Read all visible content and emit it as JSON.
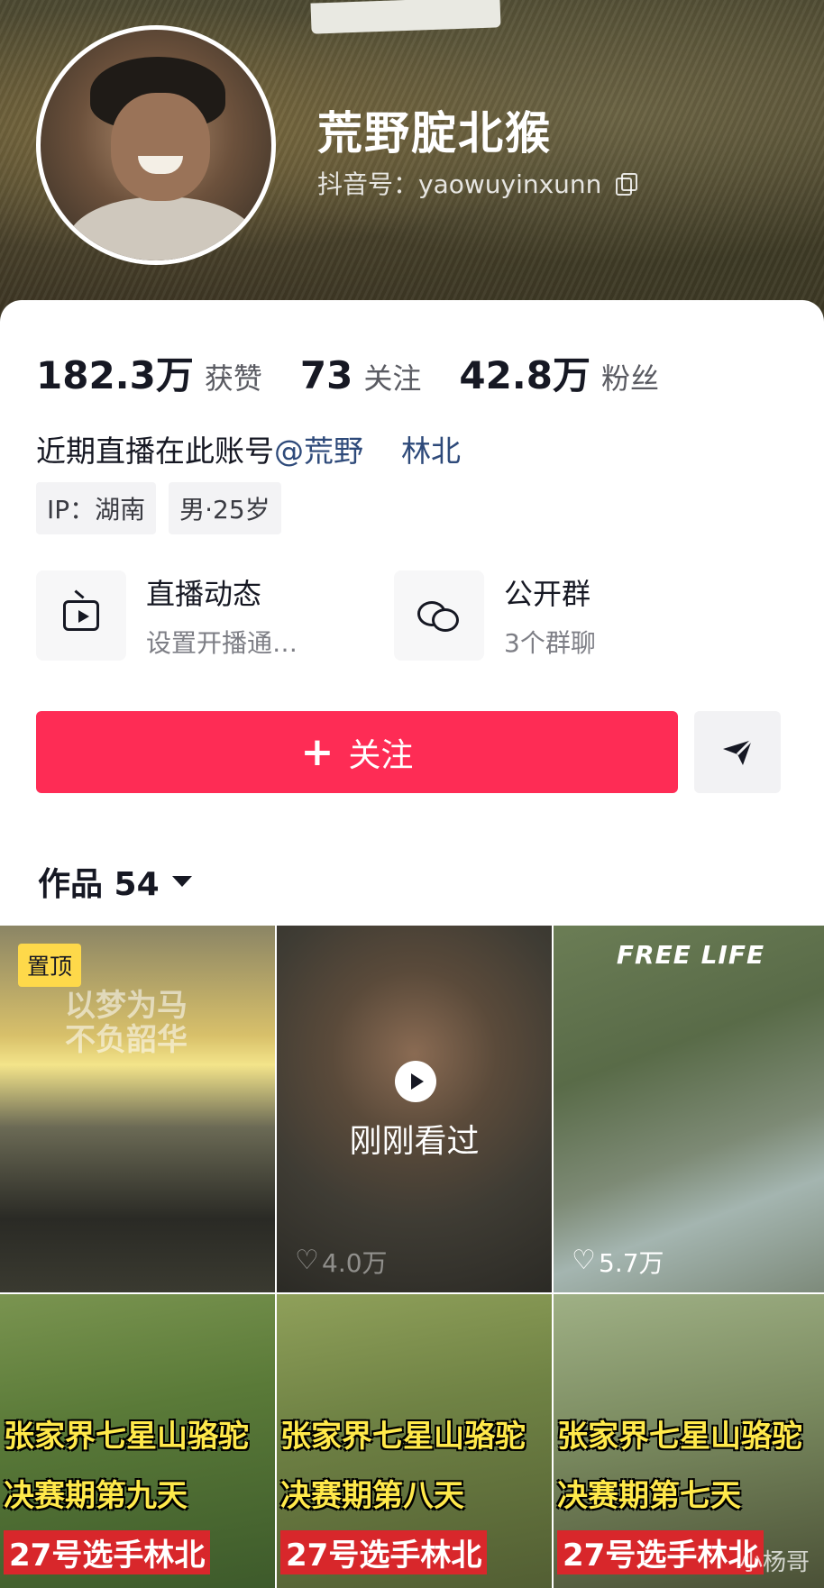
{
  "profile": {
    "name": "荒野腚北猴",
    "douyin_id": "抖音号：yaowuyinxunn"
  },
  "stats": [
    {
      "value": "182.3万",
      "label": "获赞"
    },
    {
      "value": "73",
      "label": "关注"
    },
    {
      "value": "42.8万",
      "label": "粉丝"
    }
  ],
  "bio": {
    "text": "近期直播在此账号",
    "mention": "@荒野",
    "tail": "林北"
  },
  "tags": [
    "IP：湖南",
    "男·25岁"
  ],
  "features": [
    {
      "title": "直播动态",
      "subtitle": "设置开播通…",
      "icon": "tv-icon"
    },
    {
      "title": "公开群",
      "subtitle": "3个群聊",
      "icon": "chat-icon"
    }
  ],
  "actions": {
    "follow_label": "关注",
    "share_icon": "send-icon"
  },
  "works_tab": "作品 54",
  "videos": [
    {
      "badge": "置顶",
      "overlay": [
        "以梦为马",
        "不负韶华"
      ],
      "likes": ""
    },
    {
      "status": "刚刚看过",
      "likes": "4.0万"
    },
    {
      "title": "FREE LIFE",
      "likes": "5.7万"
    },
    {
      "caption": [
        "张家界七星山骆驼",
        "决赛期第九天",
        "27号选手林北"
      ]
    },
    {
      "caption": [
        "张家界七星山骆驼",
        "决赛期第八天",
        "27号选手林北"
      ]
    },
    {
      "caption": [
        "张家界七星山骆驼",
        "决赛期第七天",
        "27号选手林北"
      ],
      "watermark": "小杨哥"
    }
  ],
  "colors": {
    "accent": "#fe2c55",
    "pin_badge": "#fed94a",
    "caption_yellow": "#ffe94a",
    "caption_red": "#d8272b"
  }
}
